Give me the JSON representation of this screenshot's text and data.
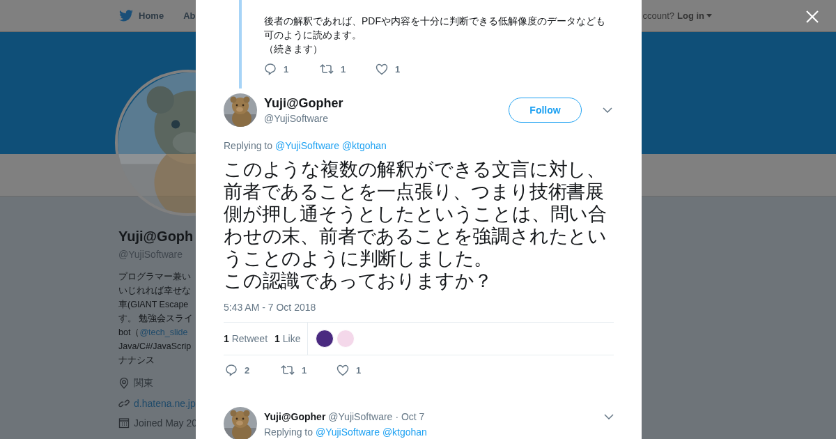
{
  "background": {
    "nav": {
      "items": [
        {
          "label": "Home"
        },
        {
          "label": "Ab"
        }
      ],
      "account_prompt": "ccount?",
      "login": "Log in"
    },
    "profile": {
      "name": "Yuji@Goph",
      "handle": "@YujiSoftware",
      "bio": [
        {
          "text": "プログラマー兼い"
        },
        {
          "text": "いじれれば幸せな"
        },
        {
          "text": "車(GIANT Escape"
        },
        {
          "text": "す。 勉強会スライ"
        },
        {
          "text": "bot（",
          "link": "@tech_slide"
        },
        {
          "text": "Java/C#/JavaScrip"
        },
        {
          "text": "ナナシス"
        }
      ],
      "location": "関東",
      "website": "d.hatena.ne.jp",
      "joined": "Joined May 20"
    }
  },
  "modal": {
    "previous_tweet": {
      "lines": [
        "後者の解釈であれば、PDFや内容を十分に判断できる低解像度のデータなども",
        "可のように読めます。",
        "（続きます）"
      ],
      "actions": {
        "replies": "1",
        "retweets": "1",
        "likes": "1"
      }
    },
    "tweet": {
      "name": "Yuji@Gopher",
      "handle": "@YujiSoftware",
      "follow": "Follow",
      "replying_label": "Replying to",
      "replying_to": [
        "@YujiSoftware",
        "@ktgohan"
      ],
      "text_lines": [
        "このような複数の解釈ができる文言に対し、",
        "前者であることを一点張り、つまり技術書展",
        "側が押し通そうとしたということは、問い合",
        "わせの末、前者であることを強調されたとい",
        "うことのように判断しました。",
        "この認識であっておりますか？"
      ],
      "timestamp": "5:43 AM - 7 Oct 2018",
      "stats": [
        {
          "count": "1",
          "label": "Retweet"
        },
        {
          "count": "1",
          "label": "Like"
        }
      ],
      "likers": [
        {
          "color": "#4a2a80"
        },
        {
          "color": "#f4d8ea"
        }
      ],
      "actions": {
        "replies": "2",
        "retweets": "1",
        "likes": "1"
      }
    },
    "reply": {
      "name": "Yuji@Gopher",
      "handle": "@YujiSoftware",
      "time": "· Oct 7",
      "replying_label": "Replying to",
      "replying_to": [
        "@YujiSoftware",
        "@ktgohan"
      ]
    }
  }
}
